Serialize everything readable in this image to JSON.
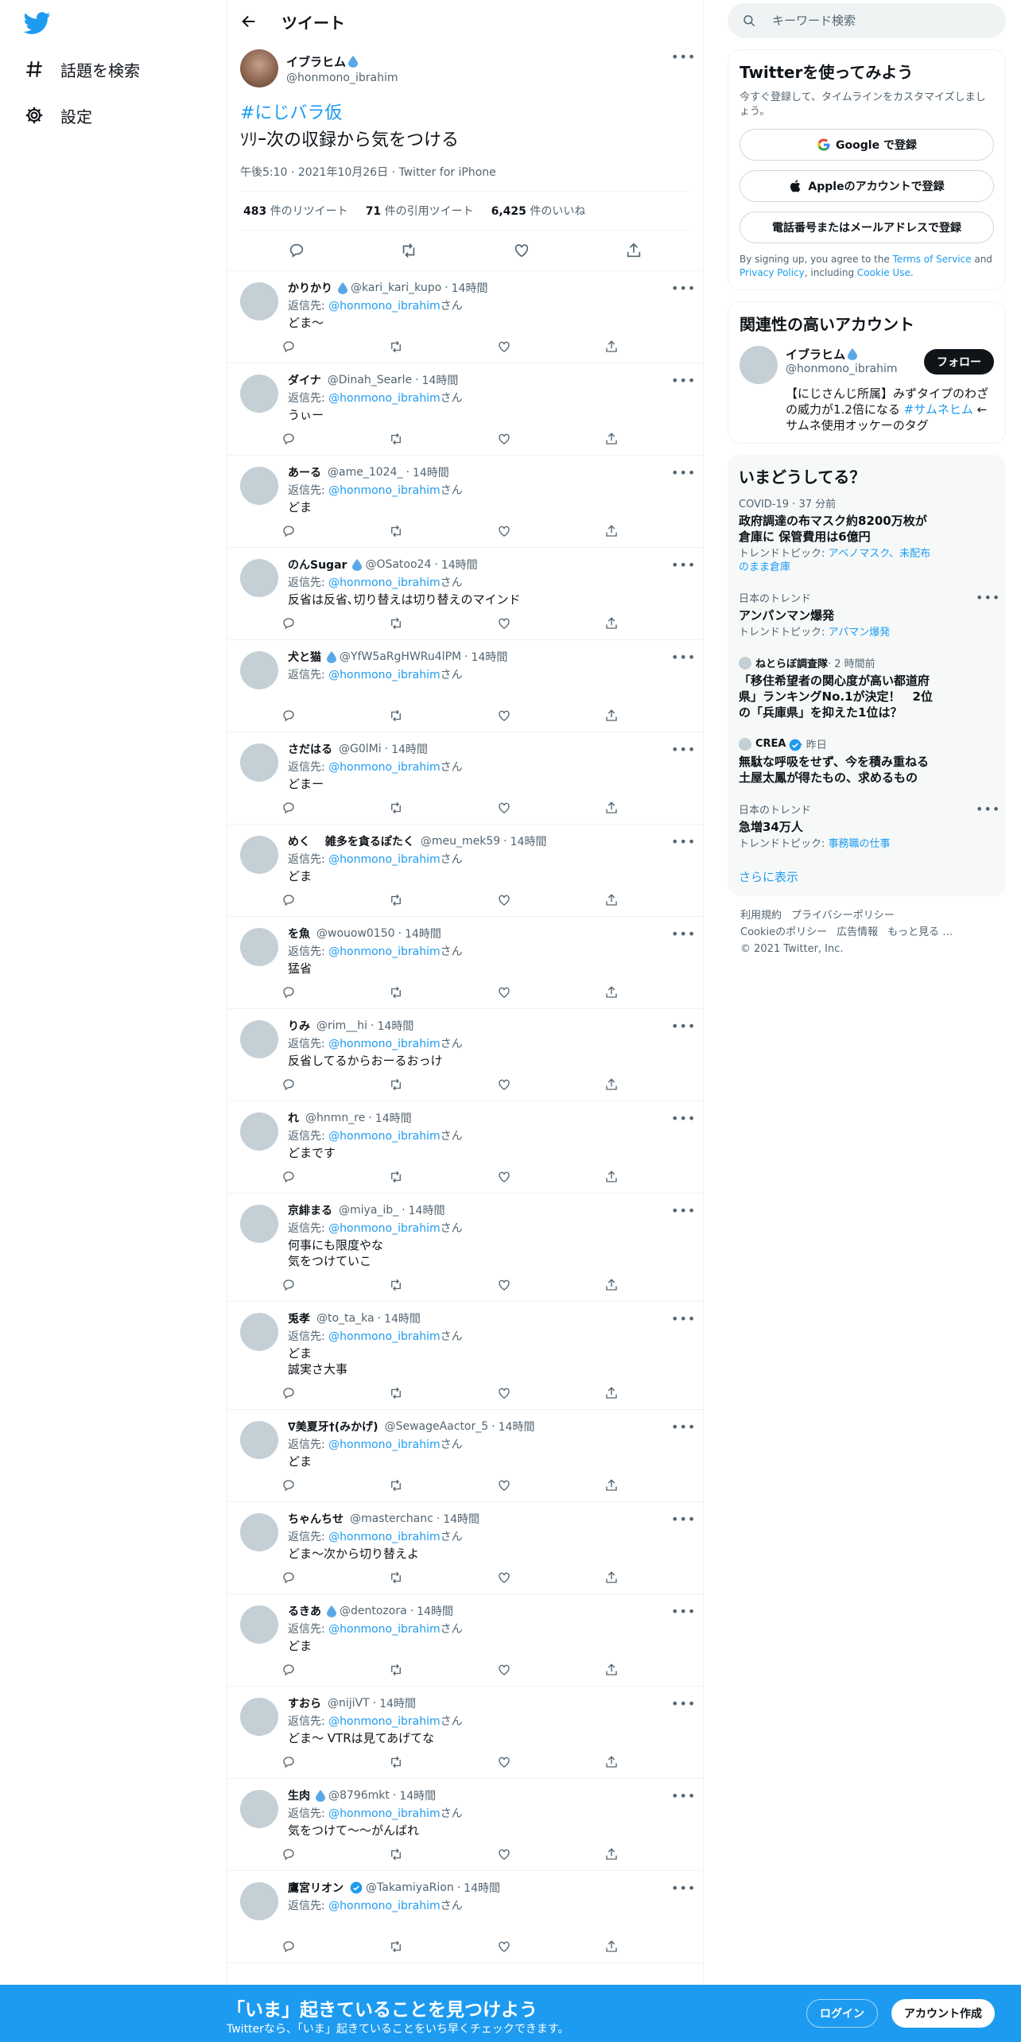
{
  "nav": {
    "items": [
      {
        "label": "話題を検索",
        "icon": "hashtag-icon"
      },
      {
        "label": "設定",
        "icon": "gear-icon"
      }
    ]
  },
  "header": {
    "title": "ツイート"
  },
  "tweet": {
    "display_name": "イブラヒム",
    "handle": "@honmono_ibrahim",
    "hashtag": "#にじバラ仮",
    "text": "ｿﾘｰ次の収録から気をつける",
    "time": "午後5:10",
    "date": "2021年10月26日",
    "client": "Twitter for iPhone",
    "retweets": "483",
    "retweets_label": "件のリツイート",
    "quotes": "71",
    "quotes_label": "件の引用ツイート",
    "likes": "6,425",
    "likes_label": "件のいいね"
  },
  "reply_prefix": "返信先: ",
  "reply_suffix": "さん",
  "reply_target": "@honmono_ibrahim",
  "replies": [
    {
      "name": "かりかり",
      "handle": "@kari_kari_kupo",
      "time": "14時間",
      "text": "どま〜",
      "drop": true
    },
    {
      "name": "ダイナ",
      "handle": "@Dinah_Searle",
      "time": "14時間",
      "text": "うぃー"
    },
    {
      "name": "あーる",
      "handle": "@ame_1024_",
      "time": "14時間",
      "text": "どま"
    },
    {
      "name": "のんSugar",
      "handle": "@OSatoo24",
      "time": "14時間",
      "text": "反省は反省､切り替えは切り替えのマインド",
      "drop": true
    },
    {
      "name": "犬と猫",
      "handle": "@YfW5aRgHWRu4lPM",
      "time": "14時間",
      "text": "",
      "drop": true
    },
    {
      "name": "さだはる",
      "handle": "@G0lMi",
      "time": "14時間",
      "text": "どまー"
    },
    {
      "name": "めく　 雑多を貪るぽたく",
      "handle": "@meu_mek59",
      "time": "14時間",
      "text": "どま"
    },
    {
      "name": "を魚",
      "handle": "@wouow0150",
      "time": "14時間",
      "text": "猛省"
    },
    {
      "name": "りみ",
      "handle": "@rim__hi",
      "time": "14時間",
      "text": "反省してるからおーるおっけ"
    },
    {
      "name": "れ",
      "handle": "@hnmn_re",
      "time": "14時間",
      "text": "どまです"
    },
    {
      "name": "京緋まる",
      "handle": "@miya_ib_",
      "time": "14時間",
      "text": "何事にも限度やな\n気をつけていこ"
    },
    {
      "name": "兎孝",
      "handle": "@to_ta_ka",
      "time": "14時間",
      "text": "どま\n誠実さ大事"
    },
    {
      "name": "∇美夏牙†(みかげ)",
      "handle": "@SewageAactor_5",
      "time": "14時間",
      "text": "どま"
    },
    {
      "name": "ちゃんちせ",
      "handle": "@masterchanc",
      "time": "14時間",
      "text": "どま〜次から切り替えよ"
    },
    {
      "name": "るきあ",
      "handle": "@dentozora",
      "time": "14時間",
      "text": "どま",
      "drop": true
    },
    {
      "name": "すおら",
      "handle": "@nijiVT",
      "time": "14時間",
      "text": "どま〜 VTRは見てあげてな"
    },
    {
      "name": "生肉",
      "handle": "@8796mkt",
      "time": "14時間",
      "text": "気をつけて〜〜がんばれ",
      "drop": true
    },
    {
      "name": "鷹宮リオン",
      "handle": "@TakamiyaRion",
      "time": "14時間",
      "text": "",
      "verified": true
    }
  ],
  "search": {
    "placeholder": "キーワード検索"
  },
  "signup_card": {
    "title": "Twitterを使ってみよう",
    "subtitle": "今すぐ登録して、タイムラインをカスタマイズしましょう。",
    "google": "Google で登録",
    "apple": "Appleのアカウントで登録",
    "phone": "電話番号またはメールアドレスで登録",
    "terms_prefix": "By signing up, you agree to the ",
    "terms_link": "Terms of Service",
    "terms_and": " and ",
    "privacy_link": "Privacy Policy",
    "terms_including": ", including ",
    "cookie_link": "Cookie Use",
    "terms_end": "."
  },
  "related": {
    "title": "関連性の高いアカウント",
    "name": "イブラヒム",
    "handle": "@honmono_ibrahim",
    "follow": "フォロー",
    "bio_text": "【にじさんじ所属】みずタイプのわざの威力が1.2倍になる ",
    "bio_tag": "#サムネヒム",
    "bio_rest": " ←サムネ使用オッケーのタグ"
  },
  "trends": {
    "title": "いまどうしてる？",
    "items": [
      {
        "meta": "COVID-19 · 37 分前",
        "title": "政府調達の布マスク約8200万枚が倉庫に 保管費用は6億円",
        "topic_prefix": "トレンドトピック: ",
        "topic": "アベノマスク、未配布のまま倉庫"
      },
      {
        "meta": "日本のトレンド",
        "title": "アンパンマン爆発",
        "topic_prefix": "トレンドトピック: ",
        "topic": "アパマン爆発",
        "more": true
      },
      {
        "source": "ねとらぼ調査隊",
        "meta": " · 2 時間前",
        "title": "「移住希望者の関心度が高い都道府県」ランキングNo.1が決定！　2位の「兵庫県」を抑えた1位は？",
        "avatar": true
      },
      {
        "source": "CREA",
        "meta": " · 昨日",
        "title": "無駄な呼吸をせず、今を積み重ねる 土屋太鳳が得たもの、求めるもの",
        "avatar": true,
        "verified": true
      },
      {
        "meta": "日本のトレンド",
        "title": "急増34万人",
        "topic_prefix": "トレンドトピック: ",
        "topic": "事務職の仕事",
        "more": true
      }
    ],
    "show_more": "さらに表示"
  },
  "footer": {
    "links": [
      "利用規約",
      "プライバシーポリシー",
      "Cookieのポリシー",
      "広告情報",
      "もっと見る …"
    ],
    "copyright": "© 2021 Twitter, Inc."
  },
  "bottom_bar": {
    "headline": "「いま」起きていることを見つけよう",
    "sub": "Twitterなら、「いま」起きていることをいち早くチェックできます。",
    "login": "ログイン",
    "signup": "アカウント作成"
  },
  "colors": {
    "accent": "#1d9bf0",
    "text": "#0f1419",
    "muted": "#536471"
  }
}
